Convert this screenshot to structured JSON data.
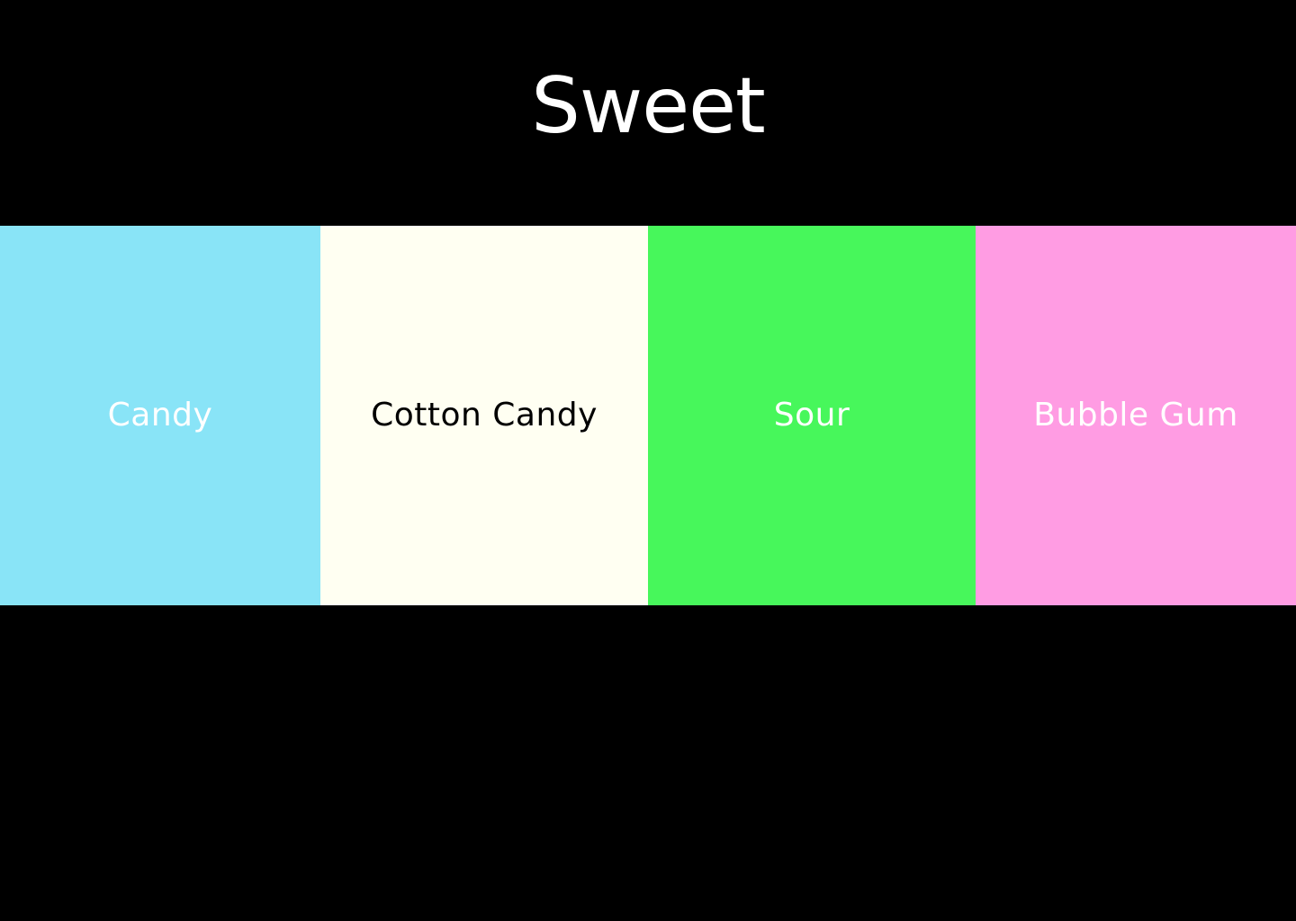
{
  "title": "Sweet",
  "swatches": [
    {
      "label": "Candy",
      "color": "#89E4F7",
      "text_color": "#FFFFFF"
    },
    {
      "label": "Cotton Candy",
      "color": "#FFFFF2",
      "text_color": "#000000"
    },
    {
      "label": "Sour",
      "color": "#47F75B",
      "text_color": "#FFFFFF"
    },
    {
      "label": "Bubble Gum",
      "color": "#FF9CE3",
      "text_color": "#FFFFFF"
    }
  ],
  "colors": {
    "background": "#000000",
    "title_text": "#FFFFFF"
  }
}
